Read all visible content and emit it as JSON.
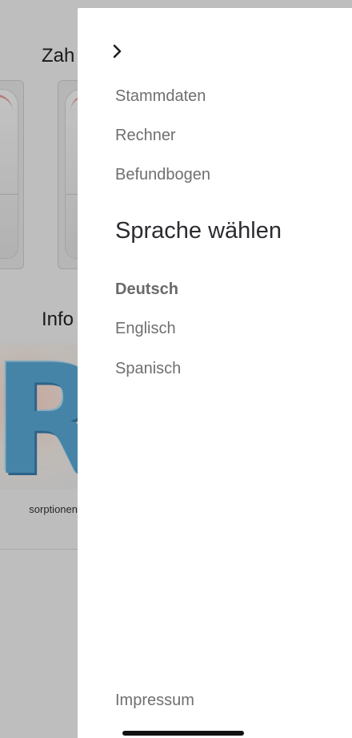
{
  "background_page": {
    "section_title_1": "Zah",
    "section_title_2": "Info",
    "info_card_label": "sorptionen",
    "info_card_glyph": "R"
  },
  "drawer": {
    "close_icon": "chevron-right-icon",
    "menu": {
      "stammdaten": "Stammdaten",
      "rechner": "Rechner",
      "befundbogen": "Befundbogen"
    },
    "language_heading": "Sprache wählen",
    "languages": {
      "deutsch": "Deutsch",
      "englisch": "Englisch",
      "spanisch": "Spanisch"
    },
    "active_language": "Deutsch",
    "impressum": "Impressum"
  },
  "colors": {
    "drawer_bg": "#ffffff",
    "menu_text": "#6f6f6f",
    "heading_text": "#2b2b30",
    "scrim": "rgba(0,0,0,0.22)",
    "accent_blue": "#5aa9d6"
  }
}
